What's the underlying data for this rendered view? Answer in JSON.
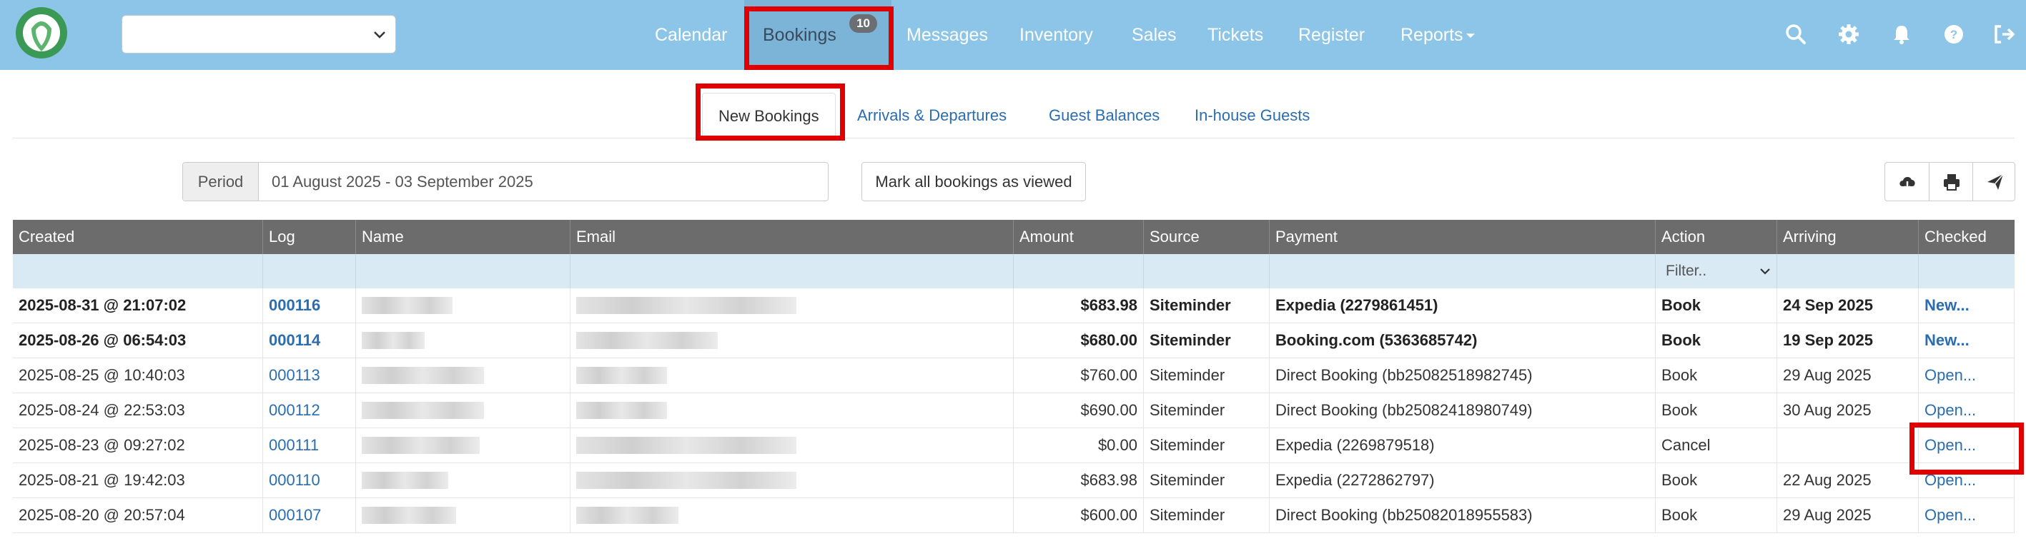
{
  "nav": {
    "items": [
      "Calendar",
      "Bookings",
      "Messages",
      "Inventory",
      "Sales",
      "Tickets",
      "Register",
      "Reports"
    ],
    "bookings_badge": "10",
    "property_select_value": "",
    "icons": [
      "search-icon",
      "gear-icon",
      "bell-icon",
      "help-icon",
      "sign-out-icon"
    ]
  },
  "subtabs": [
    "New Bookings",
    "Arrivals & Departures",
    "Guest Balances",
    "In-house Guests"
  ],
  "toolbar": {
    "period_label": "Period",
    "period_value": "01 August 2025 - 03 September 2025",
    "mark_all": "Mark all bookings as viewed",
    "icons": [
      "cloud-download-icon",
      "print-icon",
      "send-icon"
    ]
  },
  "table": {
    "headers": [
      "Created",
      "Log",
      "Name",
      "Email",
      "Amount",
      "Source",
      "Payment",
      "Action",
      "Arriving",
      "Checked"
    ],
    "filter_placeholder": "Filter..",
    "rows": [
      {
        "created": "2025-08-31 @ 21:07:02",
        "log": "000116",
        "amount": "$683.98",
        "source": "Siteminder",
        "payment": "Expedia (2279861451)",
        "action": "Book",
        "arriving": "24 Sep 2025",
        "checked": "New...",
        "unviewed": true
      },
      {
        "created": "2025-08-26 @ 06:54:03",
        "log": "000114",
        "amount": "$680.00",
        "source": "Siteminder",
        "payment": "Booking.com (5363685742)",
        "action": "Book",
        "arriving": "19 Sep 2025",
        "checked": "New...",
        "unviewed": true
      },
      {
        "created": "2025-08-25 @ 10:40:03",
        "log": "000113",
        "amount": "$760.00",
        "source": "Siteminder",
        "payment": "Direct Booking (bb25082518982745)",
        "action": "Book",
        "arriving": "29 Aug 2025",
        "checked": "Open...",
        "unviewed": false
      },
      {
        "created": "2025-08-24 @ 22:53:03",
        "log": "000112",
        "amount": "$690.00",
        "source": "Siteminder",
        "payment": "Direct Booking (bb25082418980749)",
        "action": "Book",
        "arriving": "30 Aug 2025",
        "checked": "Open...",
        "unviewed": false
      },
      {
        "created": "2025-08-23 @ 09:27:02",
        "log": "000111",
        "amount": "$0.00",
        "source": "Siteminder",
        "payment": "Expedia (2269879518)",
        "action": "Cancel",
        "arriving": "",
        "checked": "Open...",
        "unviewed": false
      },
      {
        "created": "2025-08-21 @ 19:42:03",
        "log": "000110",
        "amount": "$683.98",
        "source": "Siteminder",
        "payment": "Expedia (2272862797)",
        "action": "Book",
        "arriving": "22 Aug 2025",
        "checked": "Open...",
        "unviewed": false
      },
      {
        "created": "2025-08-20 @ 20:57:04",
        "log": "000107",
        "amount": "$600.00",
        "source": "Siteminder",
        "payment": "Direct Booking (bb25082018955583)",
        "action": "Book",
        "arriving": "29 Aug 2025",
        "checked": "Open...",
        "unviewed": false
      }
    ]
  },
  "colors": {
    "navbar": "#8cc5e8",
    "table_header": "#6c6c6c",
    "filter_row": "#d9eaf5",
    "link": "#2a6db0",
    "highlight": "#e00000"
  }
}
